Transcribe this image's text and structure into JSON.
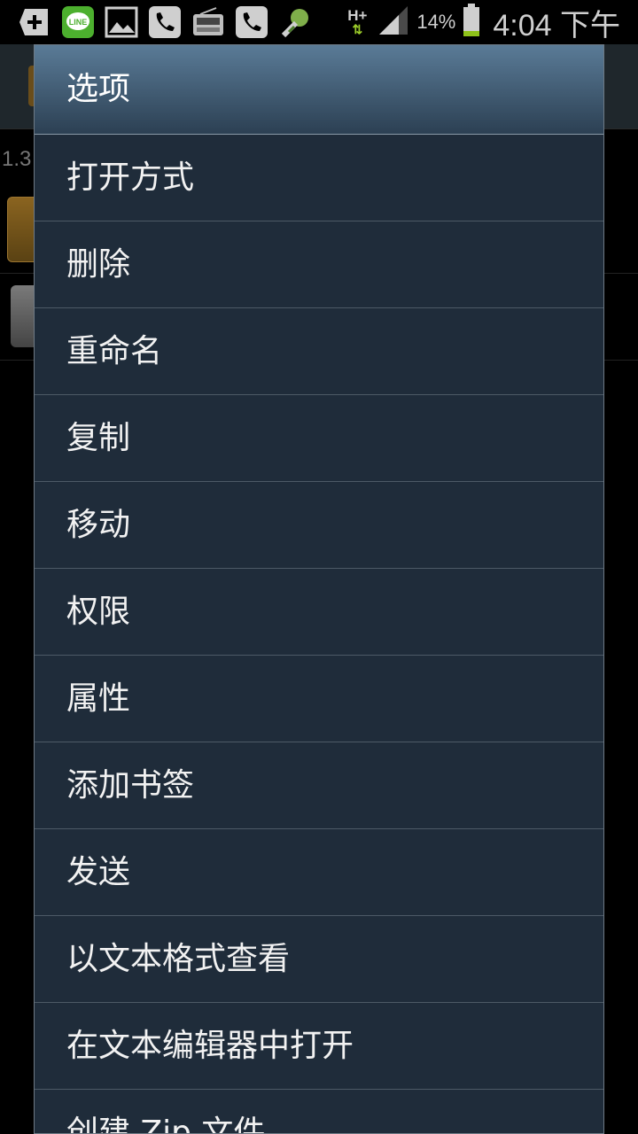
{
  "status_bar": {
    "icons": [
      "add-icon",
      "line-app-icon",
      "image-icon",
      "phone-icon",
      "radio-icon",
      "phone-icon",
      "wrench-icon"
    ],
    "network_type": "H+",
    "battery_percent": "14%",
    "time": "4:04 下午"
  },
  "background": {
    "size_text": "1.3"
  },
  "dialog": {
    "title": "选项",
    "items": [
      {
        "label": "打开方式"
      },
      {
        "label": "删除"
      },
      {
        "label": "重命名"
      },
      {
        "label": "复制"
      },
      {
        "label": "移动"
      },
      {
        "label": "权限"
      },
      {
        "label": "属性"
      },
      {
        "label": "添加书签"
      },
      {
        "label": "发送"
      },
      {
        "label": "以文本格式查看"
      },
      {
        "label": "在文本编辑器中打开"
      },
      {
        "label": "创建 Zip 文件"
      }
    ]
  },
  "colors": {
    "dialog_background": "#1f2c3a",
    "header_top": "#5a7b97",
    "header_bottom": "#2c4053",
    "divider": "#4d5a66",
    "text": "#f2f2f2"
  }
}
